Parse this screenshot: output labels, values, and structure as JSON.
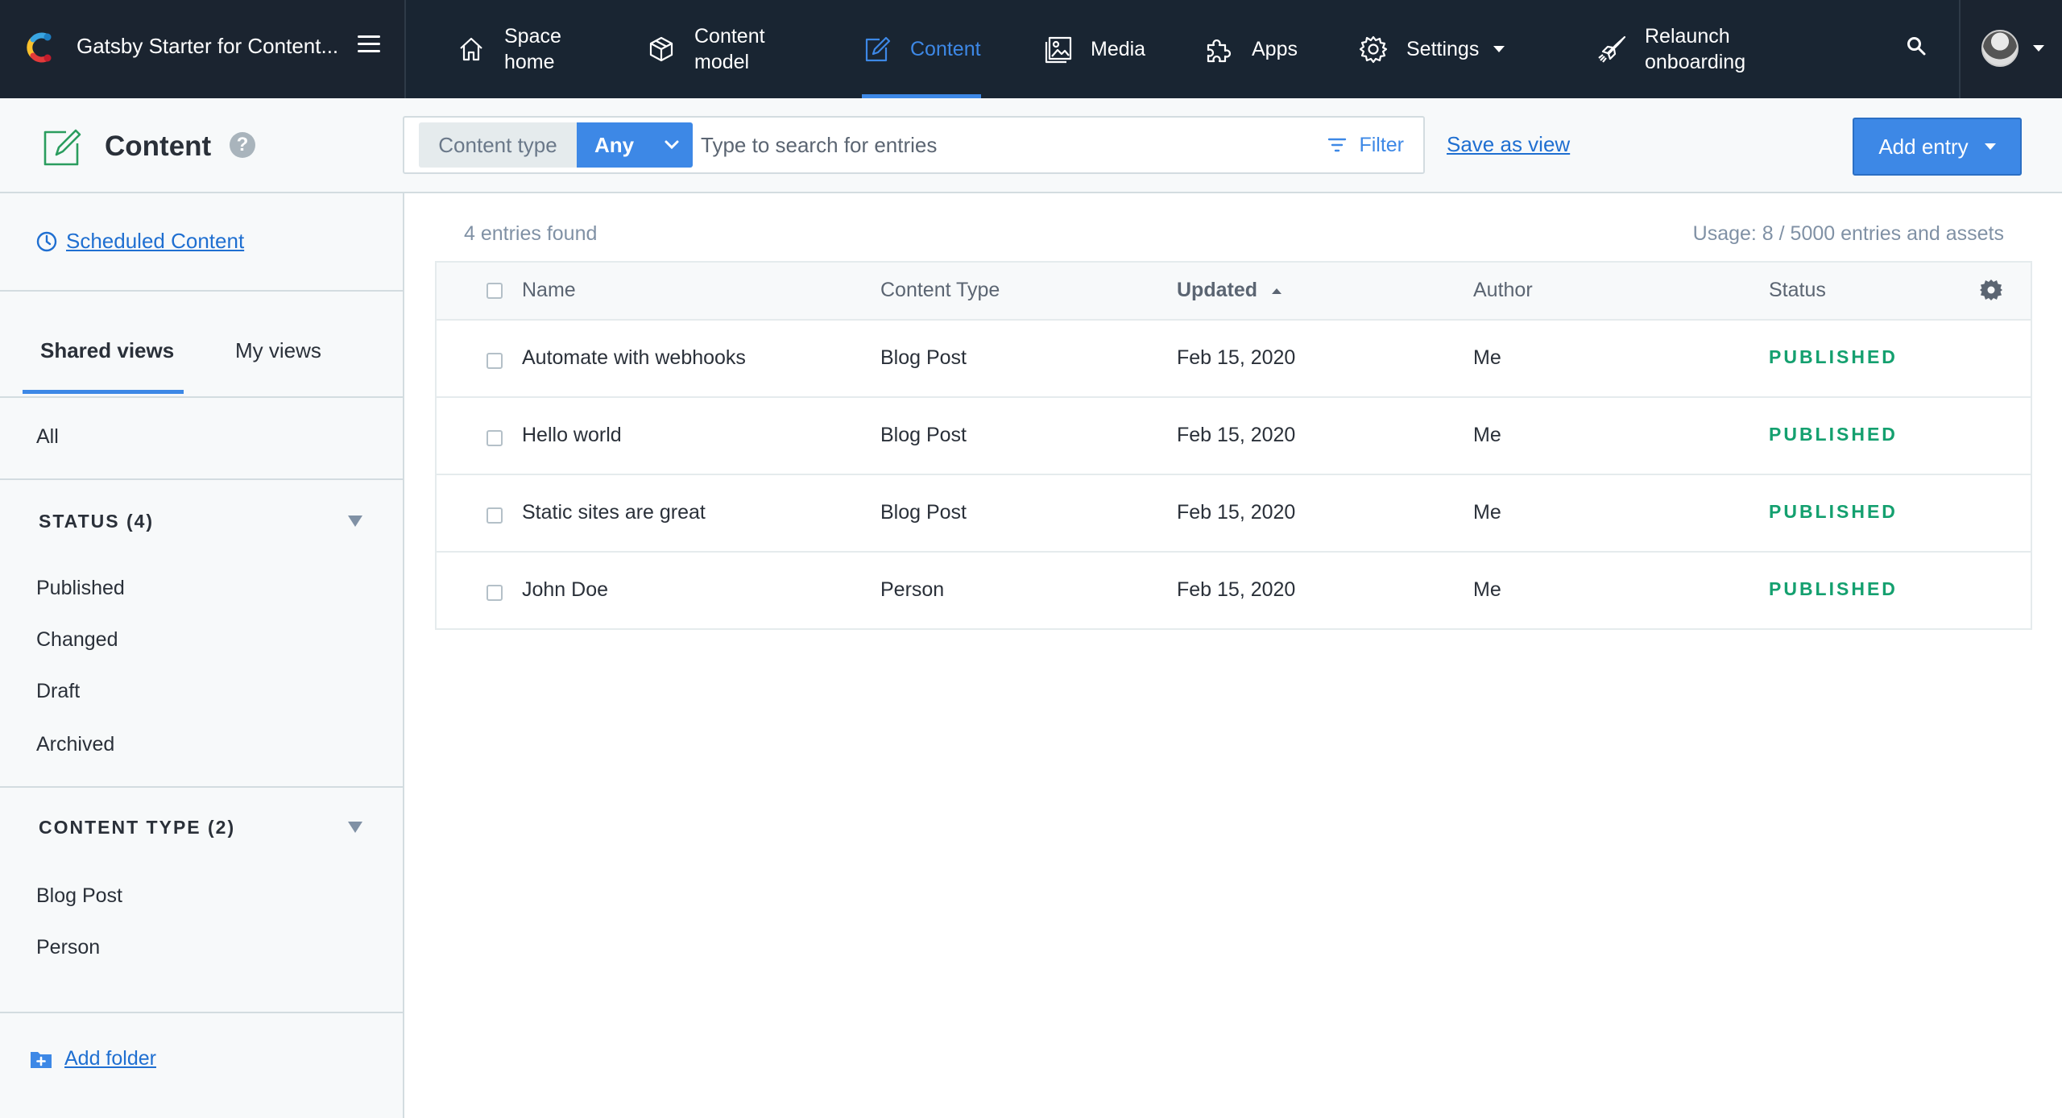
{
  "app": {
    "space_name": "Gatsby Starter for Content...",
    "colors": {
      "topbar": "#192532",
      "accent": "#3d88e6",
      "published": "#14a06f",
      "link": "#1f6fd1"
    }
  },
  "nav": {
    "space_home": "Space home",
    "content_model": "Content model",
    "content": "Content",
    "media": "Media",
    "apps": "Apps",
    "settings": "Settings",
    "relaunch": "Relaunch onboarding"
  },
  "header": {
    "title": "Content",
    "help": "?",
    "content_type_label": "Content type",
    "content_type_value": "Any",
    "search_placeholder": "Type to search for entries",
    "filter_label": "Filter",
    "save_view_label": "Save as view",
    "add_entry_label": "Add entry"
  },
  "sidebar": {
    "scheduled": "Scheduled Content",
    "tabs": {
      "shared": "Shared views",
      "mine": "My views"
    },
    "all": "All",
    "status_heading": "STATUS (4)",
    "status_items": [
      "Published",
      "Changed",
      "Draft",
      "Archived"
    ],
    "content_type_heading": "CONTENT TYPE (2)",
    "content_type_items": [
      "Blog Post",
      "Person"
    ],
    "add_folder": "Add folder"
  },
  "main": {
    "entries_found": "4 entries found",
    "usage": "Usage: 8 / 5000 entries and assets",
    "columns": {
      "name": "Name",
      "content_type": "Content Type",
      "updated": "Updated",
      "author": "Author",
      "status": "Status"
    },
    "rows": [
      {
        "name": "Automate with webhooks",
        "content_type": "Blog Post",
        "updated": "Feb 15, 2020",
        "author": "Me",
        "status": "PUBLISHED"
      },
      {
        "name": "Hello world",
        "content_type": "Blog Post",
        "updated": "Feb 15, 2020",
        "author": "Me",
        "status": "PUBLISHED"
      },
      {
        "name": "Static sites are great",
        "content_type": "Blog Post",
        "updated": "Feb 15, 2020",
        "author": "Me",
        "status": "PUBLISHED"
      },
      {
        "name": "John Doe",
        "content_type": "Person",
        "updated": "Feb 15, 2020",
        "author": "Me",
        "status": "PUBLISHED"
      }
    ]
  },
  "icons": {
    "logo": "contentful-logo-icon",
    "menu": "hamburger-icon",
    "home": "home-icon",
    "model": "cube-icon",
    "content": "edit-icon",
    "media": "image-icon",
    "apps": "puzzle-icon",
    "settings": "gear-icon",
    "relaunch": "rocket-icon",
    "search": "search-icon",
    "clock": "clock-icon",
    "folder": "folder-plus-icon"
  }
}
